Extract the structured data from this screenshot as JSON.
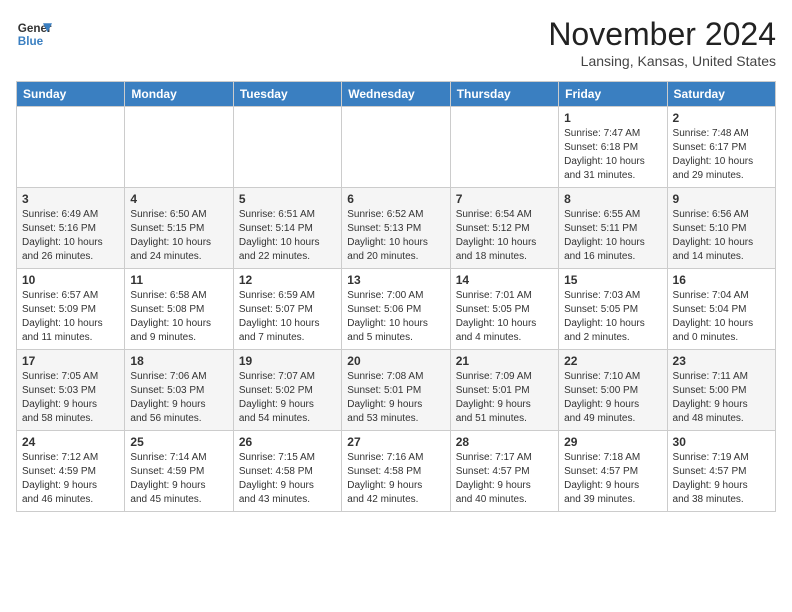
{
  "header": {
    "logo_line1": "General",
    "logo_line2": "Blue",
    "month": "November 2024",
    "location": "Lansing, Kansas, United States"
  },
  "weekdays": [
    "Sunday",
    "Monday",
    "Tuesday",
    "Wednesday",
    "Thursday",
    "Friday",
    "Saturday"
  ],
  "weeks": [
    [
      {
        "day": "",
        "info": ""
      },
      {
        "day": "",
        "info": ""
      },
      {
        "day": "",
        "info": ""
      },
      {
        "day": "",
        "info": ""
      },
      {
        "day": "",
        "info": ""
      },
      {
        "day": "1",
        "info": "Sunrise: 7:47 AM\nSunset: 6:18 PM\nDaylight: 10 hours\nand 31 minutes."
      },
      {
        "day": "2",
        "info": "Sunrise: 7:48 AM\nSunset: 6:17 PM\nDaylight: 10 hours\nand 29 minutes."
      }
    ],
    [
      {
        "day": "3",
        "info": "Sunrise: 6:49 AM\nSunset: 5:16 PM\nDaylight: 10 hours\nand 26 minutes."
      },
      {
        "day": "4",
        "info": "Sunrise: 6:50 AM\nSunset: 5:15 PM\nDaylight: 10 hours\nand 24 minutes."
      },
      {
        "day": "5",
        "info": "Sunrise: 6:51 AM\nSunset: 5:14 PM\nDaylight: 10 hours\nand 22 minutes."
      },
      {
        "day": "6",
        "info": "Sunrise: 6:52 AM\nSunset: 5:13 PM\nDaylight: 10 hours\nand 20 minutes."
      },
      {
        "day": "7",
        "info": "Sunrise: 6:54 AM\nSunset: 5:12 PM\nDaylight: 10 hours\nand 18 minutes."
      },
      {
        "day": "8",
        "info": "Sunrise: 6:55 AM\nSunset: 5:11 PM\nDaylight: 10 hours\nand 16 minutes."
      },
      {
        "day": "9",
        "info": "Sunrise: 6:56 AM\nSunset: 5:10 PM\nDaylight: 10 hours\nand 14 minutes."
      }
    ],
    [
      {
        "day": "10",
        "info": "Sunrise: 6:57 AM\nSunset: 5:09 PM\nDaylight: 10 hours\nand 11 minutes."
      },
      {
        "day": "11",
        "info": "Sunrise: 6:58 AM\nSunset: 5:08 PM\nDaylight: 10 hours\nand 9 minutes."
      },
      {
        "day": "12",
        "info": "Sunrise: 6:59 AM\nSunset: 5:07 PM\nDaylight: 10 hours\nand 7 minutes."
      },
      {
        "day": "13",
        "info": "Sunrise: 7:00 AM\nSunset: 5:06 PM\nDaylight: 10 hours\nand 5 minutes."
      },
      {
        "day": "14",
        "info": "Sunrise: 7:01 AM\nSunset: 5:05 PM\nDaylight: 10 hours\nand 4 minutes."
      },
      {
        "day": "15",
        "info": "Sunrise: 7:03 AM\nSunset: 5:05 PM\nDaylight: 10 hours\nand 2 minutes."
      },
      {
        "day": "16",
        "info": "Sunrise: 7:04 AM\nSunset: 5:04 PM\nDaylight: 10 hours\nand 0 minutes."
      }
    ],
    [
      {
        "day": "17",
        "info": "Sunrise: 7:05 AM\nSunset: 5:03 PM\nDaylight: 9 hours\nand 58 minutes."
      },
      {
        "day": "18",
        "info": "Sunrise: 7:06 AM\nSunset: 5:03 PM\nDaylight: 9 hours\nand 56 minutes."
      },
      {
        "day": "19",
        "info": "Sunrise: 7:07 AM\nSunset: 5:02 PM\nDaylight: 9 hours\nand 54 minutes."
      },
      {
        "day": "20",
        "info": "Sunrise: 7:08 AM\nSunset: 5:01 PM\nDaylight: 9 hours\nand 53 minutes."
      },
      {
        "day": "21",
        "info": "Sunrise: 7:09 AM\nSunset: 5:01 PM\nDaylight: 9 hours\nand 51 minutes."
      },
      {
        "day": "22",
        "info": "Sunrise: 7:10 AM\nSunset: 5:00 PM\nDaylight: 9 hours\nand 49 minutes."
      },
      {
        "day": "23",
        "info": "Sunrise: 7:11 AM\nSunset: 5:00 PM\nDaylight: 9 hours\nand 48 minutes."
      }
    ],
    [
      {
        "day": "24",
        "info": "Sunrise: 7:12 AM\nSunset: 4:59 PM\nDaylight: 9 hours\nand 46 minutes."
      },
      {
        "day": "25",
        "info": "Sunrise: 7:14 AM\nSunset: 4:59 PM\nDaylight: 9 hours\nand 45 minutes."
      },
      {
        "day": "26",
        "info": "Sunrise: 7:15 AM\nSunset: 4:58 PM\nDaylight: 9 hours\nand 43 minutes."
      },
      {
        "day": "27",
        "info": "Sunrise: 7:16 AM\nSunset: 4:58 PM\nDaylight: 9 hours\nand 42 minutes."
      },
      {
        "day": "28",
        "info": "Sunrise: 7:17 AM\nSunset: 4:57 PM\nDaylight: 9 hours\nand 40 minutes."
      },
      {
        "day": "29",
        "info": "Sunrise: 7:18 AM\nSunset: 4:57 PM\nDaylight: 9 hours\nand 39 minutes."
      },
      {
        "day": "30",
        "info": "Sunrise: 7:19 AM\nSunset: 4:57 PM\nDaylight: 9 hours\nand 38 minutes."
      }
    ]
  ]
}
